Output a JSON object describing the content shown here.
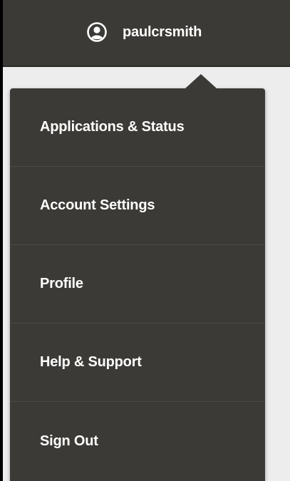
{
  "header": {
    "user_icon": "user-circle-icon",
    "username": "paulcrsmith"
  },
  "menu": {
    "items": [
      {
        "label": "Applications & Status"
      },
      {
        "label": "Account Settings"
      },
      {
        "label": "Profile"
      },
      {
        "label": "Help & Support"
      },
      {
        "label": "Sign Out"
      }
    ]
  },
  "colors": {
    "header_bg": "#3b3a36",
    "menu_bg": "#3b3a36",
    "divider": "#4b4a45",
    "text": "#ffffff",
    "page_bg": "#ededed"
  }
}
